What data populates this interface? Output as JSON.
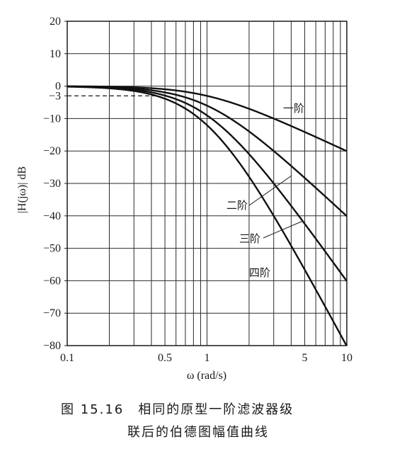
{
  "chart_data": {
    "type": "line",
    "xscale": "log",
    "xlim": [
      0.1,
      10
    ],
    "ylim": [
      -80,
      20
    ],
    "grid": true,
    "xlabel": "ω (rad/s)",
    "ylabel": "|H(jω)| dB",
    "xticks": [
      0.1,
      0.5,
      1,
      5,
      10
    ],
    "xtick_labels": [
      "0.1",
      "0.5",
      "1",
      "5",
      "10"
    ],
    "yticks": [
      20,
      10,
      0,
      -3,
      -10,
      -20,
      -30,
      -40,
      -50,
      -60,
      -70,
      -80
    ],
    "ytick_labels": [
      "20",
      "10",
      "0",
      "−3",
      "−10",
      "−20",
      "−30",
      "−40",
      "−50",
      "−60",
      "−70",
      "−80"
    ],
    "reference_line": {
      "y": -3,
      "style": "dashed"
    },
    "series": [
      {
        "name": "一阶",
        "order": 1
      },
      {
        "name": "二阶",
        "order": 2
      },
      {
        "name": "三阶",
        "order": 3
      },
      {
        "name": "四阶",
        "order": 4
      }
    ]
  },
  "caption": {
    "line1": "图 15.16　相同的原型一阶滤波器级",
    "line2": "联后的伯德图幅值曲线"
  }
}
